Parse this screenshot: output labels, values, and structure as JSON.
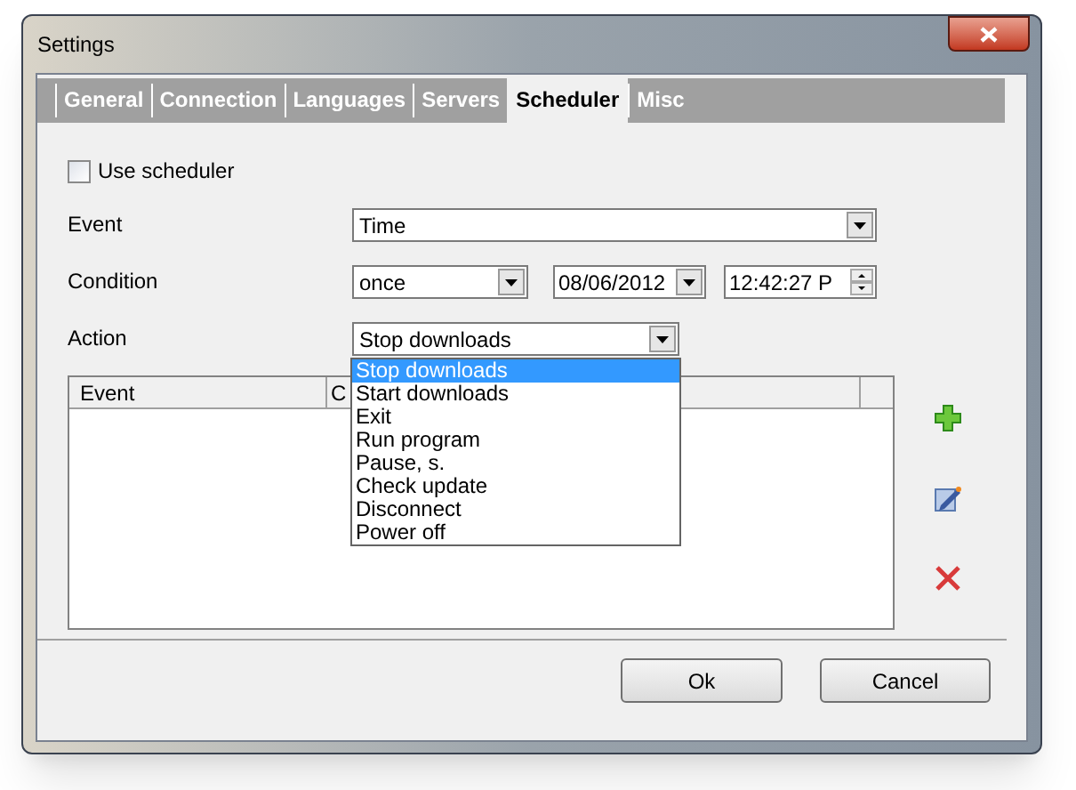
{
  "window": {
    "title": "Settings"
  },
  "tabs": [
    {
      "label": "General",
      "selected": false
    },
    {
      "label": "Connection",
      "selected": false
    },
    {
      "label": "Languages",
      "selected": false
    },
    {
      "label": "Servers",
      "selected": false
    },
    {
      "label": "Scheduler",
      "selected": true
    },
    {
      "label": "Misc",
      "selected": false
    }
  ],
  "use_scheduler": {
    "label": "Use scheduler",
    "checked": false
  },
  "event": {
    "label": "Event",
    "value": "Time"
  },
  "condition": {
    "label": "Condition",
    "repeat": "once",
    "date": "08/06/2012",
    "time": "12:42:27 P"
  },
  "action": {
    "label": "Action",
    "value": "Stop downloads",
    "expanded": true,
    "options": [
      {
        "label": "Stop downloads",
        "selected": true
      },
      {
        "label": "Start downloads",
        "selected": false
      },
      {
        "label": "Exit",
        "selected": false
      },
      {
        "label": "Run program",
        "selected": false
      },
      {
        "label": "Pause, s.",
        "selected": false
      },
      {
        "label": "Check update",
        "selected": false
      },
      {
        "label": "Disconnect",
        "selected": false
      },
      {
        "label": "Power off",
        "selected": false
      }
    ]
  },
  "table": {
    "columns": [
      "Event",
      "C"
    ]
  },
  "buttons": [
    "Ok",
    "Cancel"
  ]
}
